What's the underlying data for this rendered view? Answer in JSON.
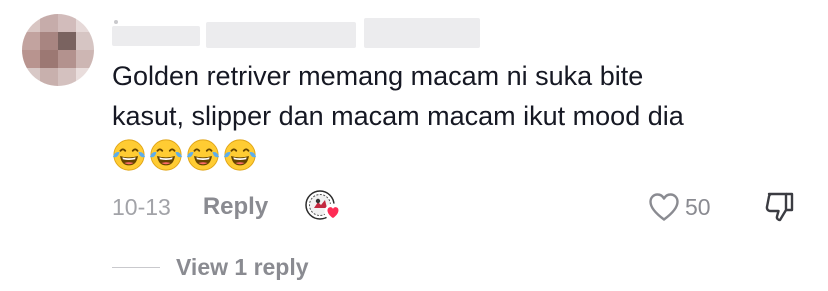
{
  "comment": {
    "text_line1": "Golden retriver memang macam ni suka bite",
    "text_line2": "kasut, slipper dan macam macam ikut mood dia",
    "emojis": [
      "face-with-tears-of-joy",
      "face-with-tears-of-joy",
      "face-with-tears-of-joy",
      "face-with-tears-of-joy"
    ]
  },
  "meta": {
    "date": "10-13",
    "reply_label": "Reply",
    "like_count": "50",
    "creator_liked": true
  },
  "replies": {
    "view_label": "View 1 reply"
  },
  "icons": {
    "like": "heart-outline-icon",
    "dislike": "thumbs-down-icon",
    "creator_like": "creator-avatar-heart-icon"
  },
  "colors": {
    "text": "#161823",
    "muted": "#8a8b91",
    "date": "#a2a3a8",
    "heart": "#fe2c55"
  }
}
